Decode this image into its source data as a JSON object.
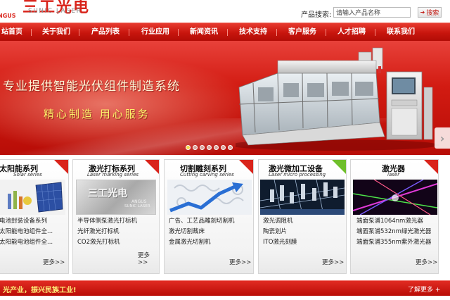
{
  "header": {
    "logo_cn": "三工光电",
    "logo_brand": "NGUS",
    "logo_en": "SUNIC LASER",
    "search_label": "产品搜索:",
    "search_value": "请输入产品名称",
    "search_button": "搜索"
  },
  "nav": {
    "items": [
      "站首页",
      "关于我们",
      "产品列表",
      "行业应用",
      "新闻资讯",
      "技术支持",
      "客户服务",
      "人才招聘",
      "联系我们"
    ]
  },
  "banner": {
    "headline": "专业提供智能光伏组件制造系统",
    "slogan": "精心制造  用心服务",
    "slide_count": 7,
    "active_slide": 1
  },
  "cards": [
    {
      "title": "太阳能系列",
      "subtitle": "Solar series",
      "items": [
        "电池封装设备系列",
        "太阳能电池组件全...",
        "太阳能电池组件全..."
      ],
      "more": "更多>>"
    },
    {
      "title": "激光打标系列",
      "subtitle": "Laser marking series",
      "image_logo_cn": "三工光电",
      "image_logo_en": "ANGUS",
      "image_logo_en2": "SUNIC LASER",
      "items": [
        "半导体侧泵激光打标机",
        "光纤激光打标机",
        "CO2激光打标机"
      ],
      "more": "更多>>"
    },
    {
      "title": "切割雕刻系列",
      "subtitle": "Cutting carving series",
      "items": [
        "广告、工艺品雕刻切割机",
        "激光切割裁床",
        "金属激光切割机"
      ],
      "more": "更多>>"
    },
    {
      "title": "激光微加工设备",
      "subtitle": "Laser micro processing",
      "items": [
        "激光调阻机",
        "陶瓷划片",
        "ITO激光刻膜"
      ],
      "more": "更多>>"
    },
    {
      "title": "激光器",
      "subtitle": "laser",
      "items": [
        "端面泵浦1064nm激光器",
        "端面泵浦532nm绿光激光器",
        "端面泵浦355nm紫外激光器"
      ],
      "more": "更多>>"
    }
  ],
  "footer_bar": {
    "slogan": "光产业，振兴民族工业!",
    "more": "了解更多 +"
  },
  "colors": {
    "brand_red": "#d9241b",
    "nav_red": "#c8150d",
    "slogan_yellow": "#fff36b"
  }
}
